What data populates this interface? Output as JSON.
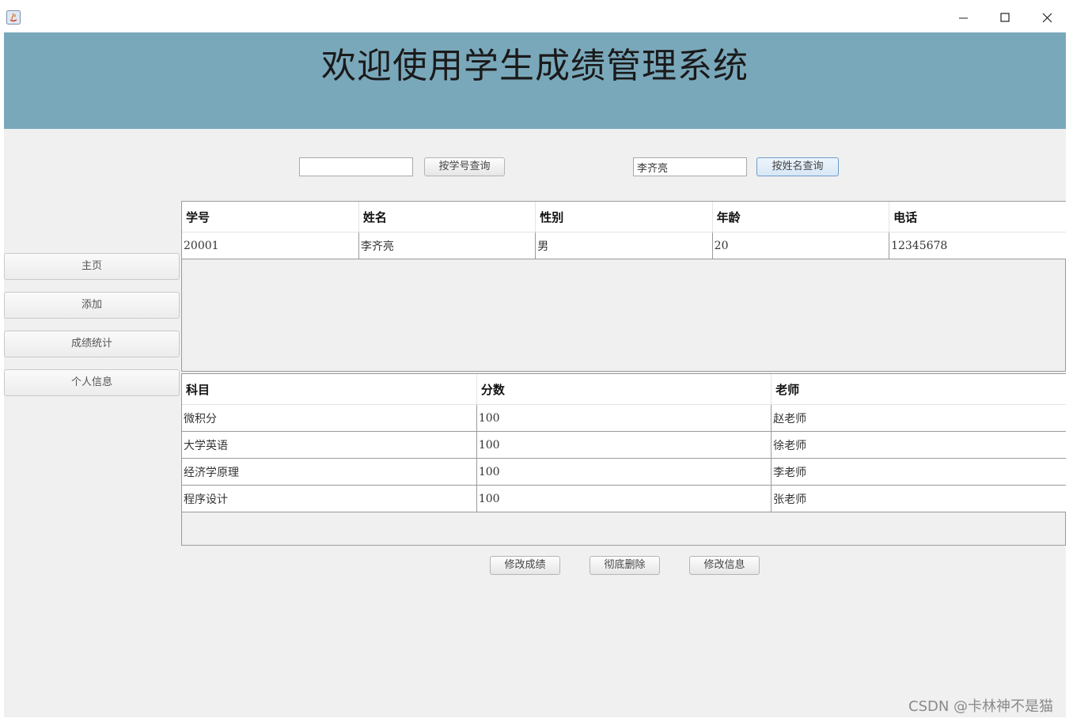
{
  "window": {
    "controls": {
      "minimize_icon": "minimize-icon",
      "maximize_icon": "maximize-icon",
      "close_icon": "close-icon"
    }
  },
  "header": {
    "title": "欢迎使用学生成绩管理系统",
    "banner_color": "#7aa8bb"
  },
  "search": {
    "id_value": "",
    "id_button_label": "按学号查询",
    "name_value": "李齐亮",
    "name_button_label": "按姓名查询"
  },
  "sidebar": {
    "items": [
      {
        "label": "主页"
      },
      {
        "label": "添加"
      },
      {
        "label": "成绩统计"
      },
      {
        "label": "个人信息"
      }
    ]
  },
  "student_table": {
    "columns": [
      "学号",
      "姓名",
      "性别",
      "年龄",
      "电话"
    ],
    "rows": [
      [
        "20001",
        "李齐亮",
        "男",
        "20",
        "12345678"
      ]
    ]
  },
  "score_table": {
    "columns": [
      "科目",
      "分数",
      "老师"
    ],
    "rows": [
      [
        "微积分",
        "100",
        "赵老师"
      ],
      [
        "大学英语",
        "100",
        "徐老师"
      ],
      [
        "经济学原理",
        "100",
        "李老师"
      ],
      [
        "程序设计",
        "100",
        "张老师"
      ]
    ]
  },
  "actions": {
    "edit_score_label": "修改成绩",
    "delete_label": "彻底删除",
    "edit_info_label": "修改信息"
  },
  "watermark": "CSDN @卡林神不是猫"
}
